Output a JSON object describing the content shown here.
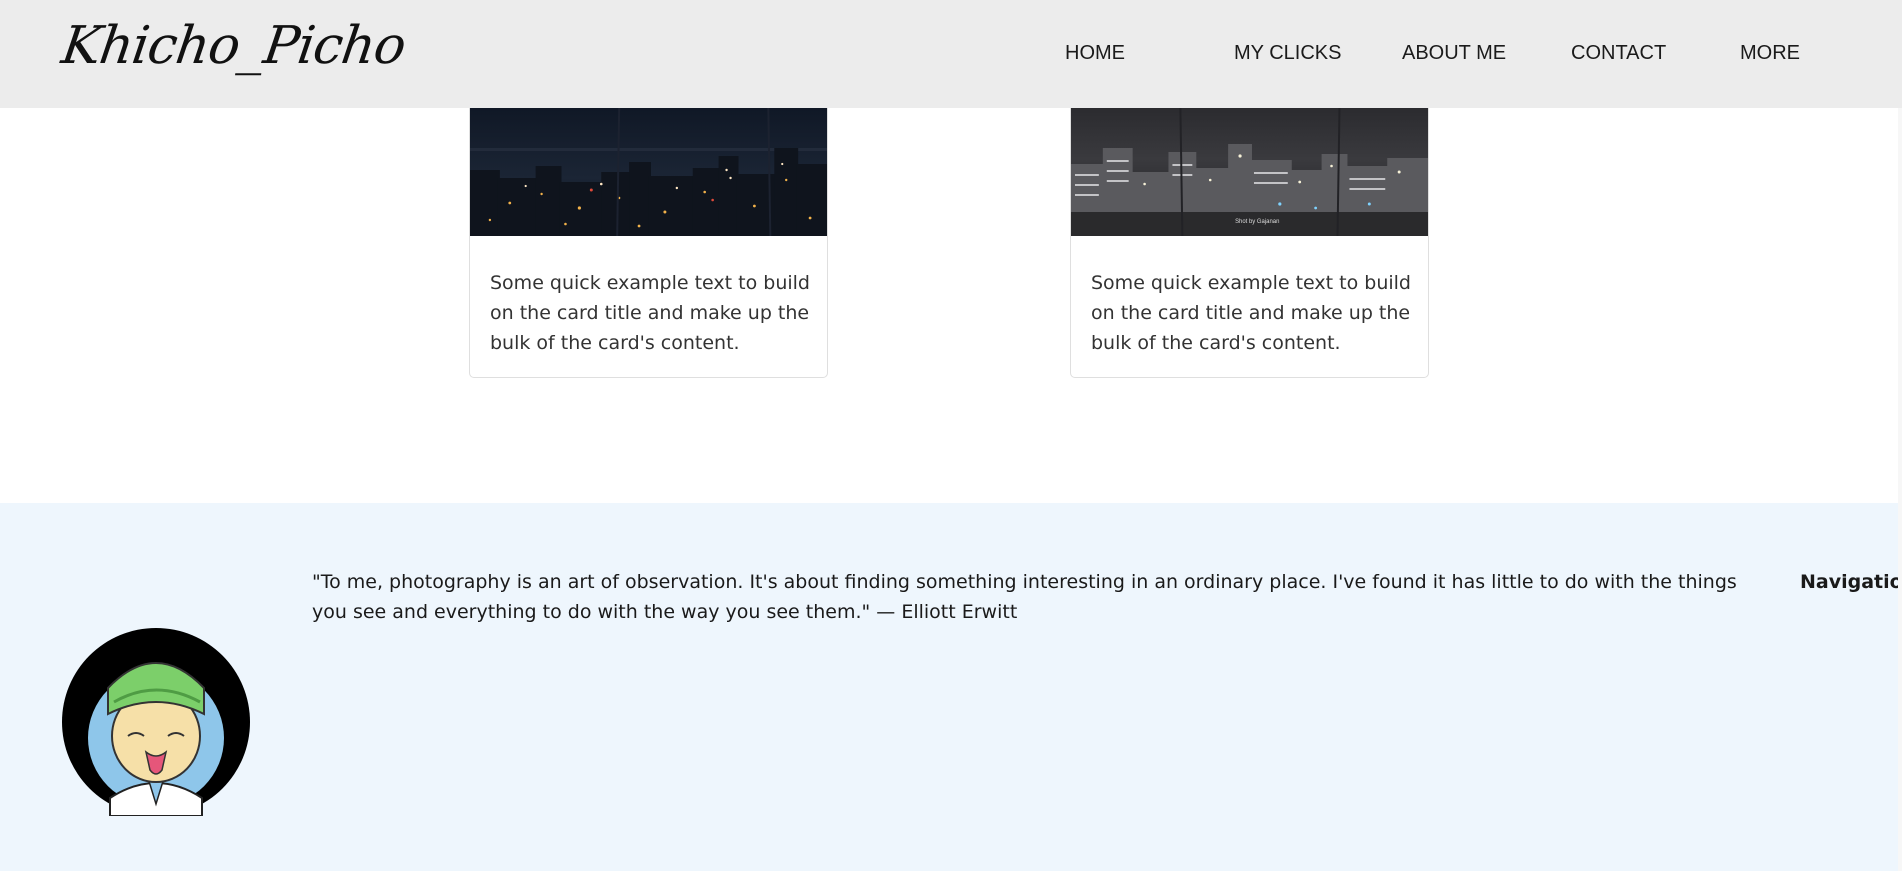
{
  "navbar": {
    "brand": "Khicho_Picho",
    "links": [
      {
        "label": "HOME"
      },
      {
        "label": "MY CLICKS"
      },
      {
        "label": "ABOUT ME"
      },
      {
        "label": "CONTACT"
      },
      {
        "label": "MORE"
      }
    ]
  },
  "cards": [
    {
      "text": "Some quick example text to build on the card title and make up the bulk of the card's content."
    },
    {
      "text": "Some quick example text to build on the card title and make up the bulk of the card's content.",
      "watermark": "Shot by Gajanan"
    }
  ],
  "footer": {
    "quote": "\"To me, photography is an art of observation. It's about finding something interesting in an ordinary place. I've found it has little to do with the things you see and everything to do with the way you see them.\" — Elliott Erwitt",
    "nav_heading": "Navigation"
  },
  "colors": {
    "navbar_bg": "#ececec",
    "footer_bg": "#eef6fd",
    "avatar_turban": "#7ccf6a",
    "avatar_bg": "#8ec6ea"
  }
}
